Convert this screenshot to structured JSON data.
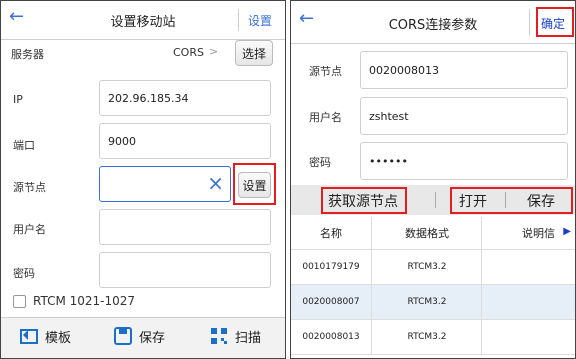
{
  "left": {
    "title": "设置移动站",
    "back_icon": "arrow-left-icon",
    "header_action": "设置",
    "server": {
      "label": "服务器",
      "value": "CORS",
      "chevron": ">",
      "select_label": "选择"
    },
    "ip": {
      "label": "IP",
      "value": "202.96.185.34"
    },
    "port": {
      "label": "端口",
      "value": "9000"
    },
    "mountpoint": {
      "label": "源节点",
      "value": "",
      "clear_icon": "×",
      "set_label": "设置"
    },
    "username": {
      "label": "用户名",
      "value": ""
    },
    "password": {
      "label": "密码",
      "value": ""
    },
    "rtcm_checkbox": {
      "label": "RTCM 1021-1027",
      "checked": false
    },
    "bottom": {
      "template_label": "模板",
      "save_label": "保存",
      "scan_label": "扫描"
    }
  },
  "right": {
    "title": "CORS连接参数",
    "back_icon": "arrow-left-icon",
    "confirm_label": "确定",
    "mountpoint": {
      "label": "源节点",
      "value": "0020008013"
    },
    "username": {
      "label": "用户名",
      "value": "zshtest"
    },
    "password": {
      "label": "密码",
      "value": "••••••"
    },
    "actions": {
      "fetch_label": "获取源节点",
      "open_label": "打开",
      "save_label": "保存"
    },
    "table": {
      "headers": [
        "名称",
        "数据格式",
        "说明信"
      ],
      "more_icon": "▶",
      "rows": [
        [
          "0010179179",
          "RTCM3.2",
          ""
        ],
        [
          "0020008007",
          "RTCM3.2",
          ""
        ],
        [
          "0020008013",
          "RTCM3.2",
          ""
        ]
      ]
    }
  },
  "colors": {
    "accent": "#3a6fd8",
    "highlight": "#e02020",
    "selected_row": "#e6eef8"
  }
}
